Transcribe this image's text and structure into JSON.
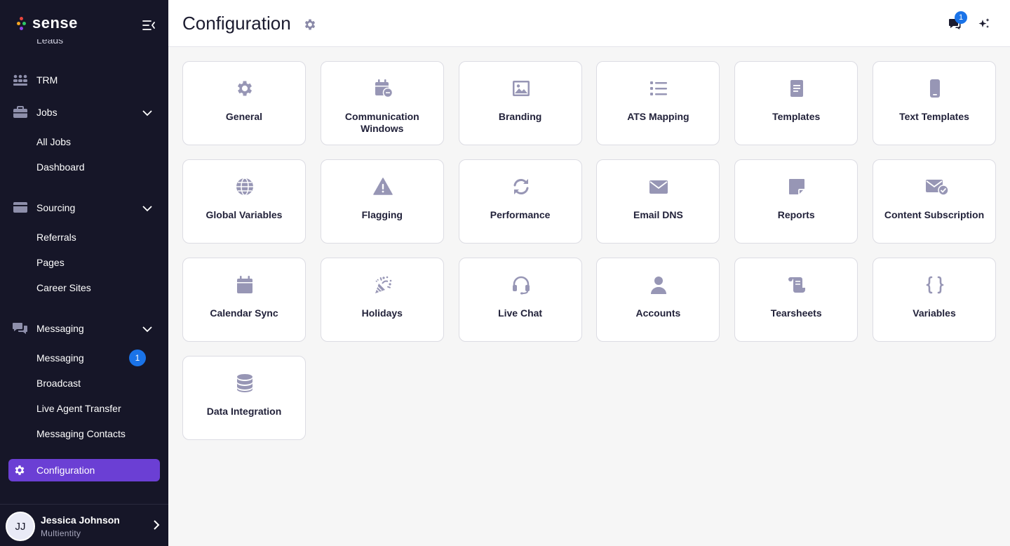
{
  "brand": {
    "name": "sense",
    "dot_colors": [
      "#e8453c",
      "#f5a623",
      "#2ec866",
      "#8e44ec"
    ]
  },
  "sidebar": {
    "clipped_item": "Leads",
    "items": [
      {
        "label": "TRM",
        "icon": "people-grid-icon"
      },
      {
        "label": "Jobs",
        "icon": "briefcase-icon",
        "children": [
          "All Jobs",
          "Dashboard"
        ]
      },
      {
        "label": "Sourcing",
        "icon": "card-icon",
        "children": [
          "Referrals",
          "Pages",
          "Career Sites"
        ]
      },
      {
        "label": "Messaging",
        "icon": "chat-bubbles-icon",
        "children": [
          "Messaging",
          "Broadcast",
          "Live Agent Transfer",
          "Messaging Contacts"
        ],
        "messaging_badge": "1"
      }
    ],
    "active": {
      "label": "Configuration",
      "icon": "gear-icon",
      "color": "#6b3fd4"
    }
  },
  "user": {
    "initials": "JJ",
    "name": "Jessica Johnson",
    "org": "Multientity"
  },
  "header": {
    "title": "Configuration",
    "notification_count": "1"
  },
  "accent_color": "#9796b5",
  "cards": [
    {
      "label": "General",
      "icon": "gear-icon"
    },
    {
      "label": "Communication Windows",
      "icon": "calendar-clock-icon"
    },
    {
      "label": "Branding",
      "icon": "image-icon"
    },
    {
      "label": "ATS Mapping",
      "icon": "list-icon"
    },
    {
      "label": "Templates",
      "icon": "document-icon"
    },
    {
      "label": "Text Templates",
      "icon": "phone-icon"
    },
    {
      "label": "Global Variables",
      "icon": "globe-icon"
    },
    {
      "label": "Flagging",
      "icon": "warning-icon"
    },
    {
      "label": "Performance",
      "icon": "refresh-icon"
    },
    {
      "label": "Email DNS",
      "icon": "envelope-icon"
    },
    {
      "label": "Reports",
      "icon": "note-icon"
    },
    {
      "label": "Content Subscription",
      "icon": "envelope-check-icon"
    },
    {
      "label": "Calendar Sync",
      "icon": "calendar-icon"
    },
    {
      "label": "Holidays",
      "icon": "confetti-icon"
    },
    {
      "label": "Live Chat",
      "icon": "headset-icon"
    },
    {
      "label": "Accounts",
      "icon": "user-icon"
    },
    {
      "label": "Tearsheets",
      "icon": "scroll-icon"
    },
    {
      "label": "Variables",
      "icon": "braces-icon"
    },
    {
      "label": "Data Integration",
      "icon": "database-icon"
    }
  ]
}
